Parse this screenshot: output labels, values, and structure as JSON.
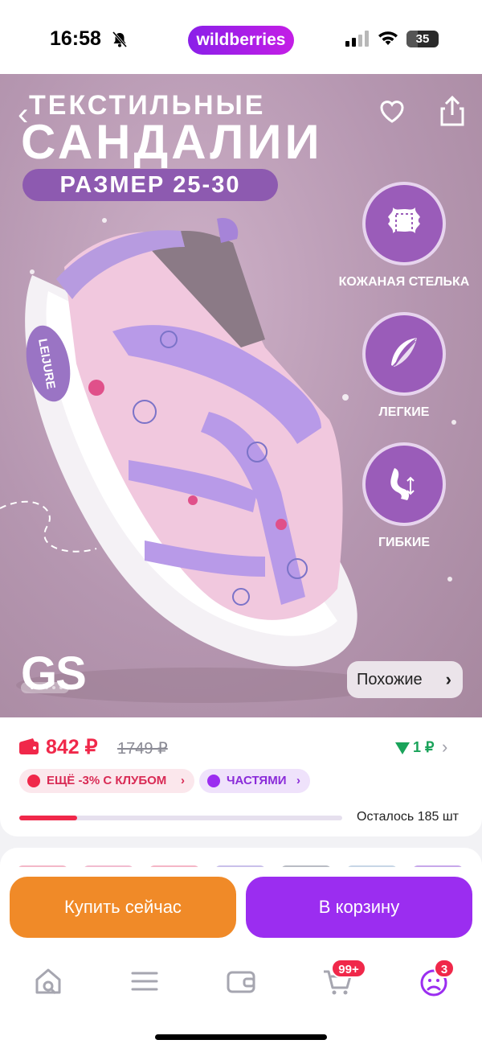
{
  "status_bar": {
    "time": "16:58",
    "app_badge": "wildberries",
    "battery": "35",
    "battery_level": 0.35
  },
  "hero": {
    "title_line1": "ТЕКСТИЛЬНЫЕ",
    "title_line2": "САНДАЛИИ",
    "size_pill": "РАЗМЕР 25-30",
    "shoe_brand_label": "LEIJURE",
    "features": [
      {
        "label": "КОЖАНАЯ СТЕЛЬКА",
        "icon": "leather-hide-icon"
      },
      {
        "label": "ЛЕГКИЕ",
        "icon": "feather-icon"
      },
      {
        "label": "ГИБКИЕ",
        "icon": "flexible-sole-icon"
      }
    ],
    "logo": "GS",
    "similar_label": "Похожие",
    "slide_count": 5,
    "current_slide": 1,
    "background_color": "#b596b0"
  },
  "price": {
    "current": "842 ₽",
    "old": "1749 ₽",
    "drop_value": "1 ₽",
    "club_badge": "ЕЩЁ -3% С КЛУБОМ",
    "installments_badge": "ЧАСТЯМИ",
    "remaining_text": "Осталось 185 шт",
    "stock_level": 0.18,
    "accent_color": "#f0284a"
  },
  "actions": {
    "buy_now": "Купить сейчас",
    "add_to_cart": "В корзину",
    "buy_color": "#f08a28",
    "cart_color": "#9b2df0"
  },
  "tab_bar": {
    "items": [
      {
        "name": "home",
        "icon": "home-search-icon"
      },
      {
        "name": "catalog",
        "icon": "menu-icon"
      },
      {
        "name": "wallet",
        "icon": "wallet-icon"
      },
      {
        "name": "cart",
        "icon": "cart-icon",
        "badge": "99+"
      },
      {
        "name": "profile",
        "icon": "profile-icon",
        "badge": "3"
      }
    ]
  }
}
